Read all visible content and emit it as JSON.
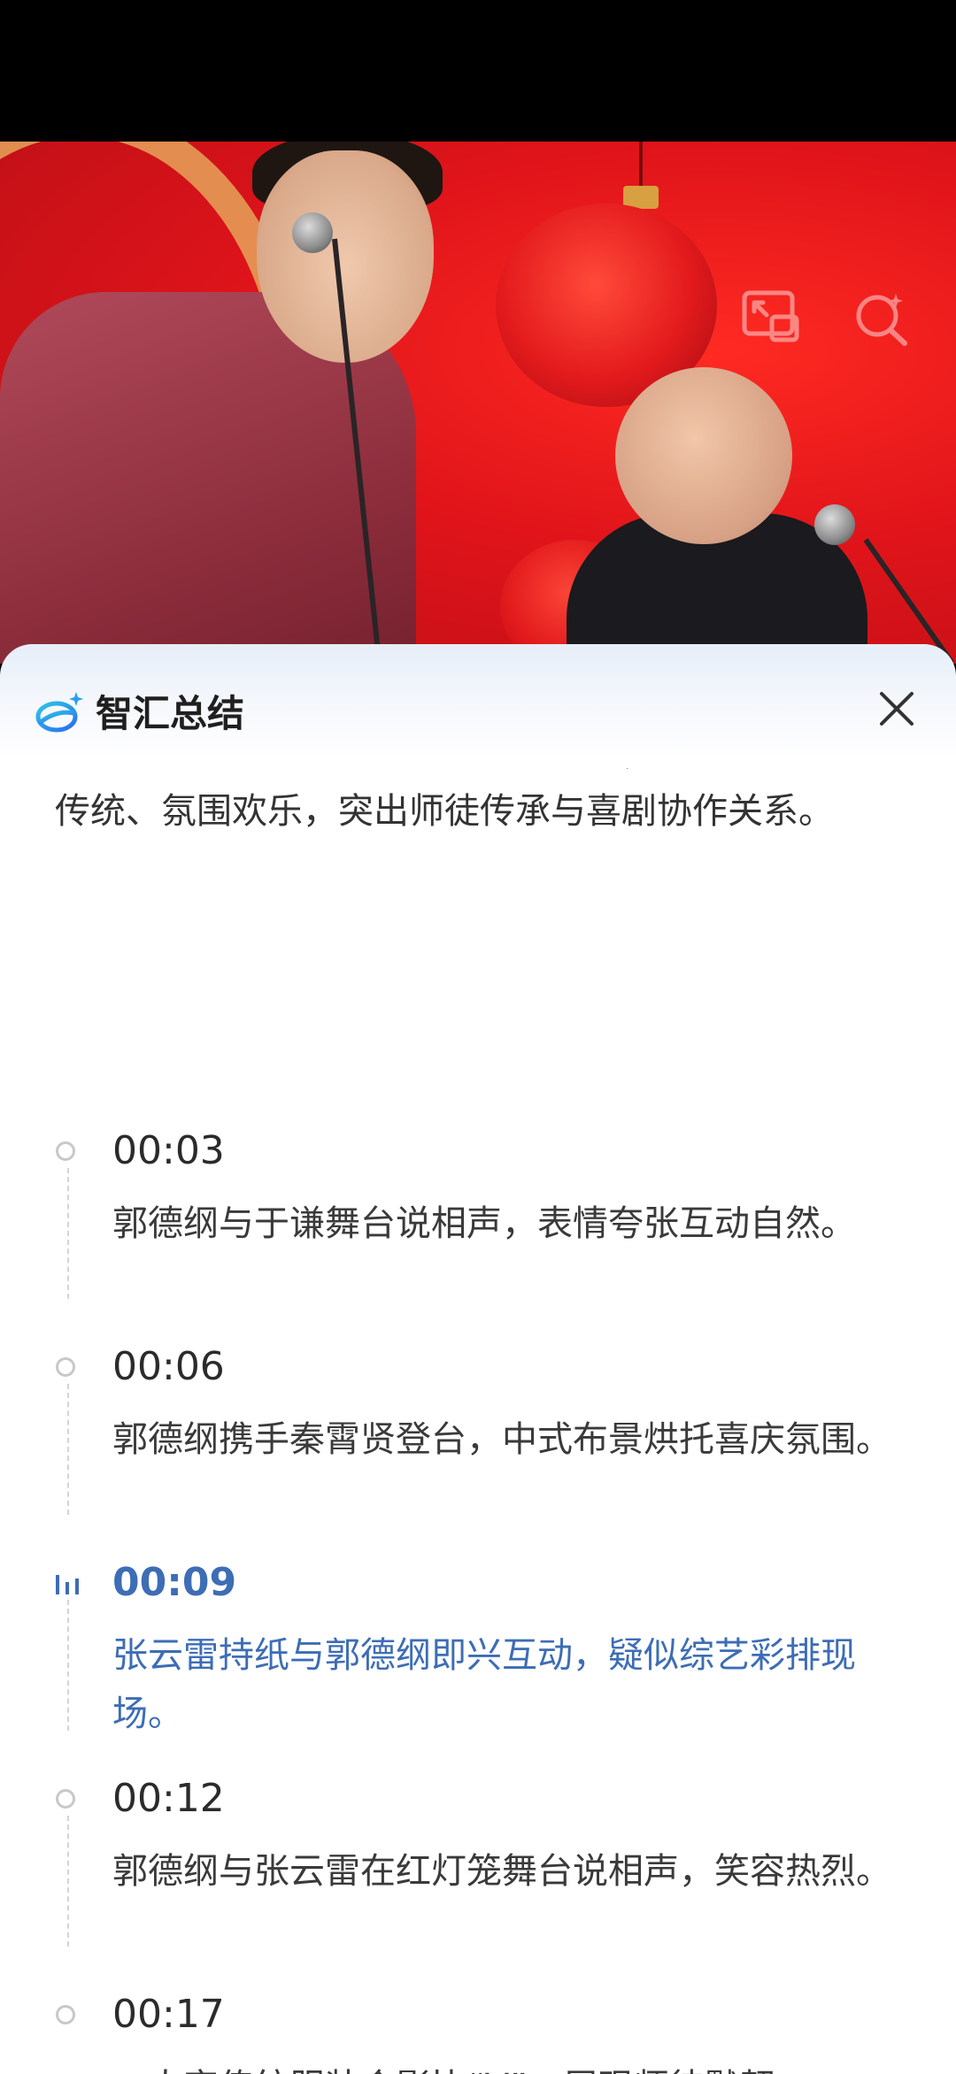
{
  "panel": {
    "title": "智汇总结",
    "logo_icon": "zhihui-logo-icon",
    "close_icon": "close-icon",
    "accent_color": "#3d6db5",
    "summary": "场合作表演，呈现轻松幽默的相声互动。关键帧显示其与于谦、秦霄贤、张云雷等搭档同台，表情生动、服饰传统、氛围欢乐，突出师徒传承与喜剧协作关系。"
  },
  "video": {
    "overlay_icons": [
      "picture-in-picture-icon",
      "ai-search-icon"
    ]
  },
  "timeline": [
    {
      "time": "00:03",
      "text": "郭德纲与于谦舞台说相声，表情夸张互动自然。",
      "active": false
    },
    {
      "time": "00:06",
      "text": "郭德纲携手秦霄贤登台，中式布景烘托喜庆氛围。",
      "active": false
    },
    {
      "time": "00:09",
      "text": "张云雷持纸与郭德纲即兴互动，疑似综艺彩排现场。",
      "active": true
    },
    {
      "time": "00:12",
      "text": "郭德纲与张云雷在红灯笼舞台说相声，笑容热烈。",
      "active": false
    },
    {
      "time": "00:17",
      "text": "二人穿传统服装合影比“V”，展现师徒默契。",
      "active": false
    }
  ]
}
